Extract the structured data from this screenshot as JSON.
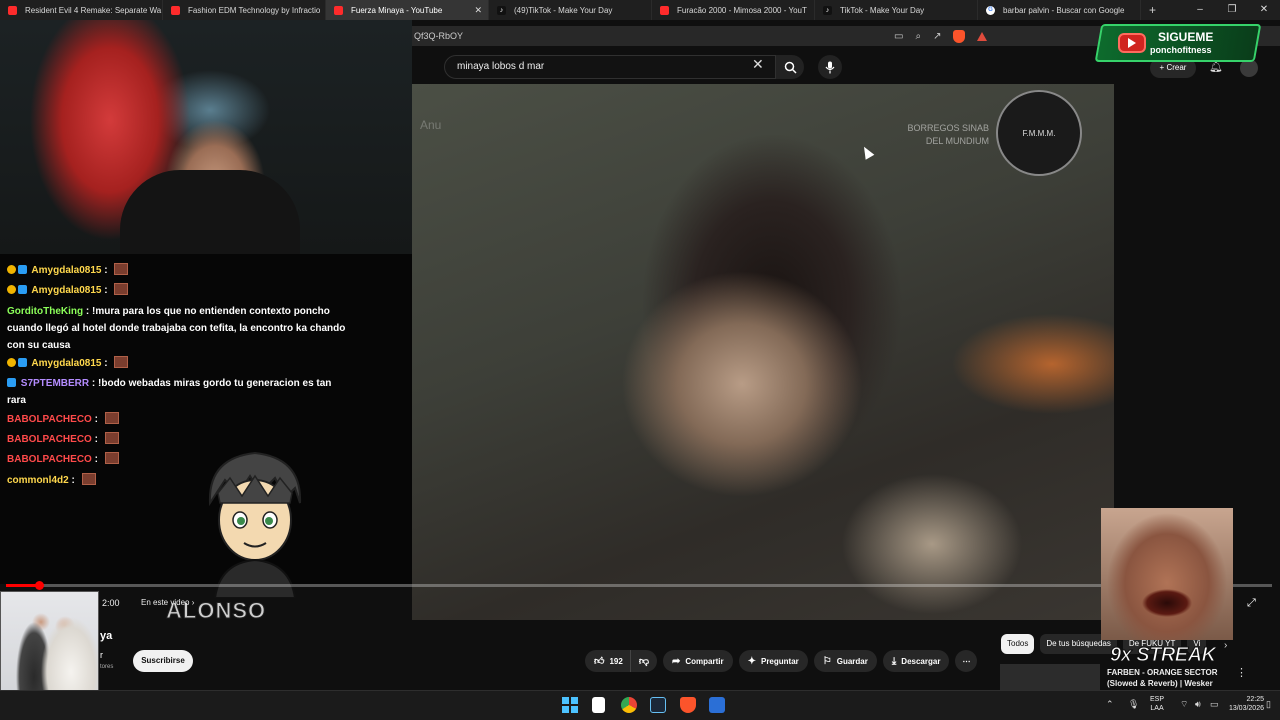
{
  "browser": {
    "tabs": [
      {
        "label": "Resident Evil 4 Remake: Separate Wa",
        "icon": "youtube-icon",
        "active": false
      },
      {
        "label": "Fashion EDM Technology by Infractio",
        "icon": "youtube-icon",
        "active": false
      },
      {
        "label": "Fuerza Minaya - YouTube",
        "icon": "youtube-icon",
        "active": true
      },
      {
        "label": "(49)TikTok - Make Your Day",
        "icon": "tiktok-icon",
        "active": false
      },
      {
        "label": "Furacão 2000 - Mimosa 2000 - YouT",
        "icon": "youtube-icon",
        "active": false
      },
      {
        "label": "TikTok - Make Your Day",
        "icon": "tiktok-icon",
        "active": false
      },
      {
        "label": "barbar palvin - Buscar con Google",
        "icon": "google-icon",
        "active": false
      }
    ],
    "new_tab": "+",
    "window_controls": [
      "–",
      "❐",
      "✕"
    ],
    "address": "Qf3Q-RbOY"
  },
  "youtube": {
    "search_query": "minaya lobos d mar",
    "clear_icon": "✕",
    "create_label": "+ Crear",
    "video": {
      "watermark": "Anu",
      "channel_overlay_line1": "BORREGOS SINAB",
      "channel_overlay_line2": "DEL MUNDIUM",
      "logo_text": "F.M.M.M.",
      "progress_fraction": 0.026,
      "timecode": "2:00",
      "chapter": "En este video",
      "chapter_chevron": "›"
    },
    "title_fragment": "ya",
    "channel_fragment": "r",
    "subscribers_fragment": "tores",
    "subscribe_label": "Suscribirse",
    "actions": {
      "likes": "192",
      "share": "Compartir",
      "ask": "Preguntar",
      "save": "Guardar",
      "download": "Descargar"
    },
    "chips": [
      "Todos",
      "De tus búsquedas",
      "De FUKU YT",
      "Vi"
    ],
    "chip_next": "›",
    "recommendation_title": "FARBEN - ORANGE SECTOR (Slowed & Reverb) | Wesker",
    "recommendation_menu": "⋮"
  },
  "stream_overlay": {
    "chat": [
      {
        "user": "Amygdala0815",
        "badges": 2,
        "color": "#ffd84d",
        "message": "",
        "emote": true
      },
      {
        "user": "Amygdala0815",
        "badges": 2,
        "color": "#ffd84d",
        "message": "",
        "emote": true
      },
      {
        "user": "GorditoTheKing",
        "badges": 0,
        "color": "#8cff5a",
        "message": "!mura para los que no entienden contexto poncho cuando llegó al hotel donde trabajaba con tefita, la encontro ka chando con su causa",
        "emote": false
      },
      {
        "user": "Amygdala0815",
        "badges": 2,
        "color": "#ffd84d",
        "message": "",
        "emote": true
      },
      {
        "user": "S7PTEMBERR",
        "badges": 1,
        "color": "#b48cff",
        "message": "!bodo webadas miras gordo tu generacion es tan rara",
        "emote": false
      },
      {
        "user": "BABOLPACHECO",
        "badges": 0,
        "color": "#ff4a4a",
        "message": "",
        "emote": true
      },
      {
        "user": "BABOLPACHECO",
        "badges": 0,
        "color": "#ff4a4a",
        "message": "",
        "emote": true
      },
      {
        "user": "BABOLPACHECO",
        "badges": 0,
        "color": "#ff4a4a",
        "message": "",
        "emote": true
      },
      {
        "user": "commonl4d2",
        "badges": 0,
        "color": "#ffd84d",
        "message": "",
        "emote": true
      }
    ],
    "avatar_name": "ALONSO",
    "follow_title": "SIGUEME",
    "follow_handle": "ponchofitness",
    "streak": "9x STREAK"
  },
  "taskbar": {
    "language_line1": "ESP",
    "language_line2": "LAA",
    "time": "22:25",
    "date": "13/03/2026"
  }
}
